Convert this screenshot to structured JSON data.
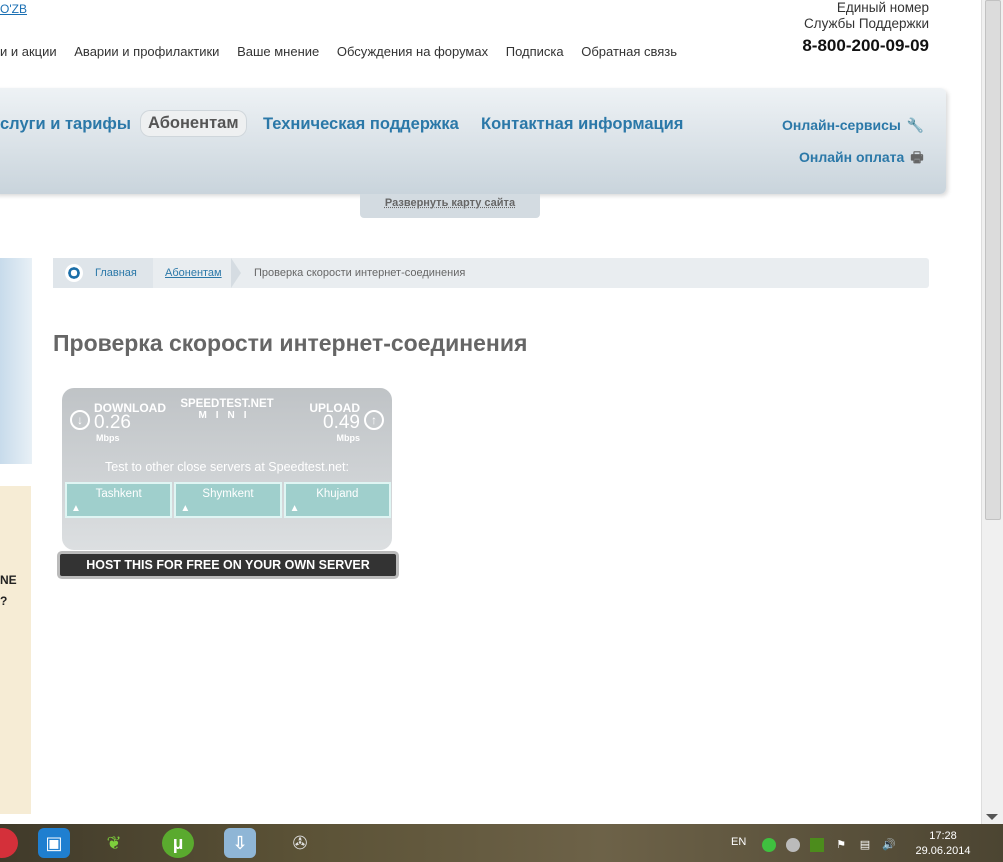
{
  "header": {
    "lang_link": "O'ZB",
    "top_menu": [
      "и и акции",
      "Аварии и профилактики",
      "Ваше мнение",
      "Обсуждения на форумах",
      "Подписка",
      "Обратная связь"
    ],
    "support_line1": "Единый номер",
    "support_line2": "Службы Поддержки",
    "support_phone": "8-800-200-09-09"
  },
  "nav": {
    "items": [
      "слуги и тарифы",
      "Абонентам",
      "Техническая поддержка",
      "Контактная информация"
    ],
    "online_services": "Онлайн-сервисы",
    "online_payment": "Онлайн оплата",
    "sitemap": "Развернуть карту сайта"
  },
  "side": {
    "text_line1": "NE",
    "text_line2": "?"
  },
  "breadcrumb": {
    "home": "Главная",
    "section": "Абонентам",
    "current": "Проверка скорости интернет-соединения"
  },
  "page_title": "Проверка скорости интернет-соединения",
  "speedtest": {
    "download_label": "DOWNLOAD",
    "download_value": "0.26",
    "download_unit": "Mbps",
    "upload_label": "UPLOAD",
    "upload_value": "0.49",
    "upload_unit": "Mbps",
    "brand": "SPEEDTEST.NET",
    "brand_sub": "MINI",
    "test_text": "Test to other close servers at Speedtest.net:",
    "servers": [
      "Tashkent",
      "Shymkent",
      "Khujand"
    ],
    "host_text": "HOST THIS FOR FREE ON YOUR OWN SERVER"
  },
  "taskbar": {
    "lang": "EN",
    "time": "17:28",
    "date": "29.06.2014"
  }
}
